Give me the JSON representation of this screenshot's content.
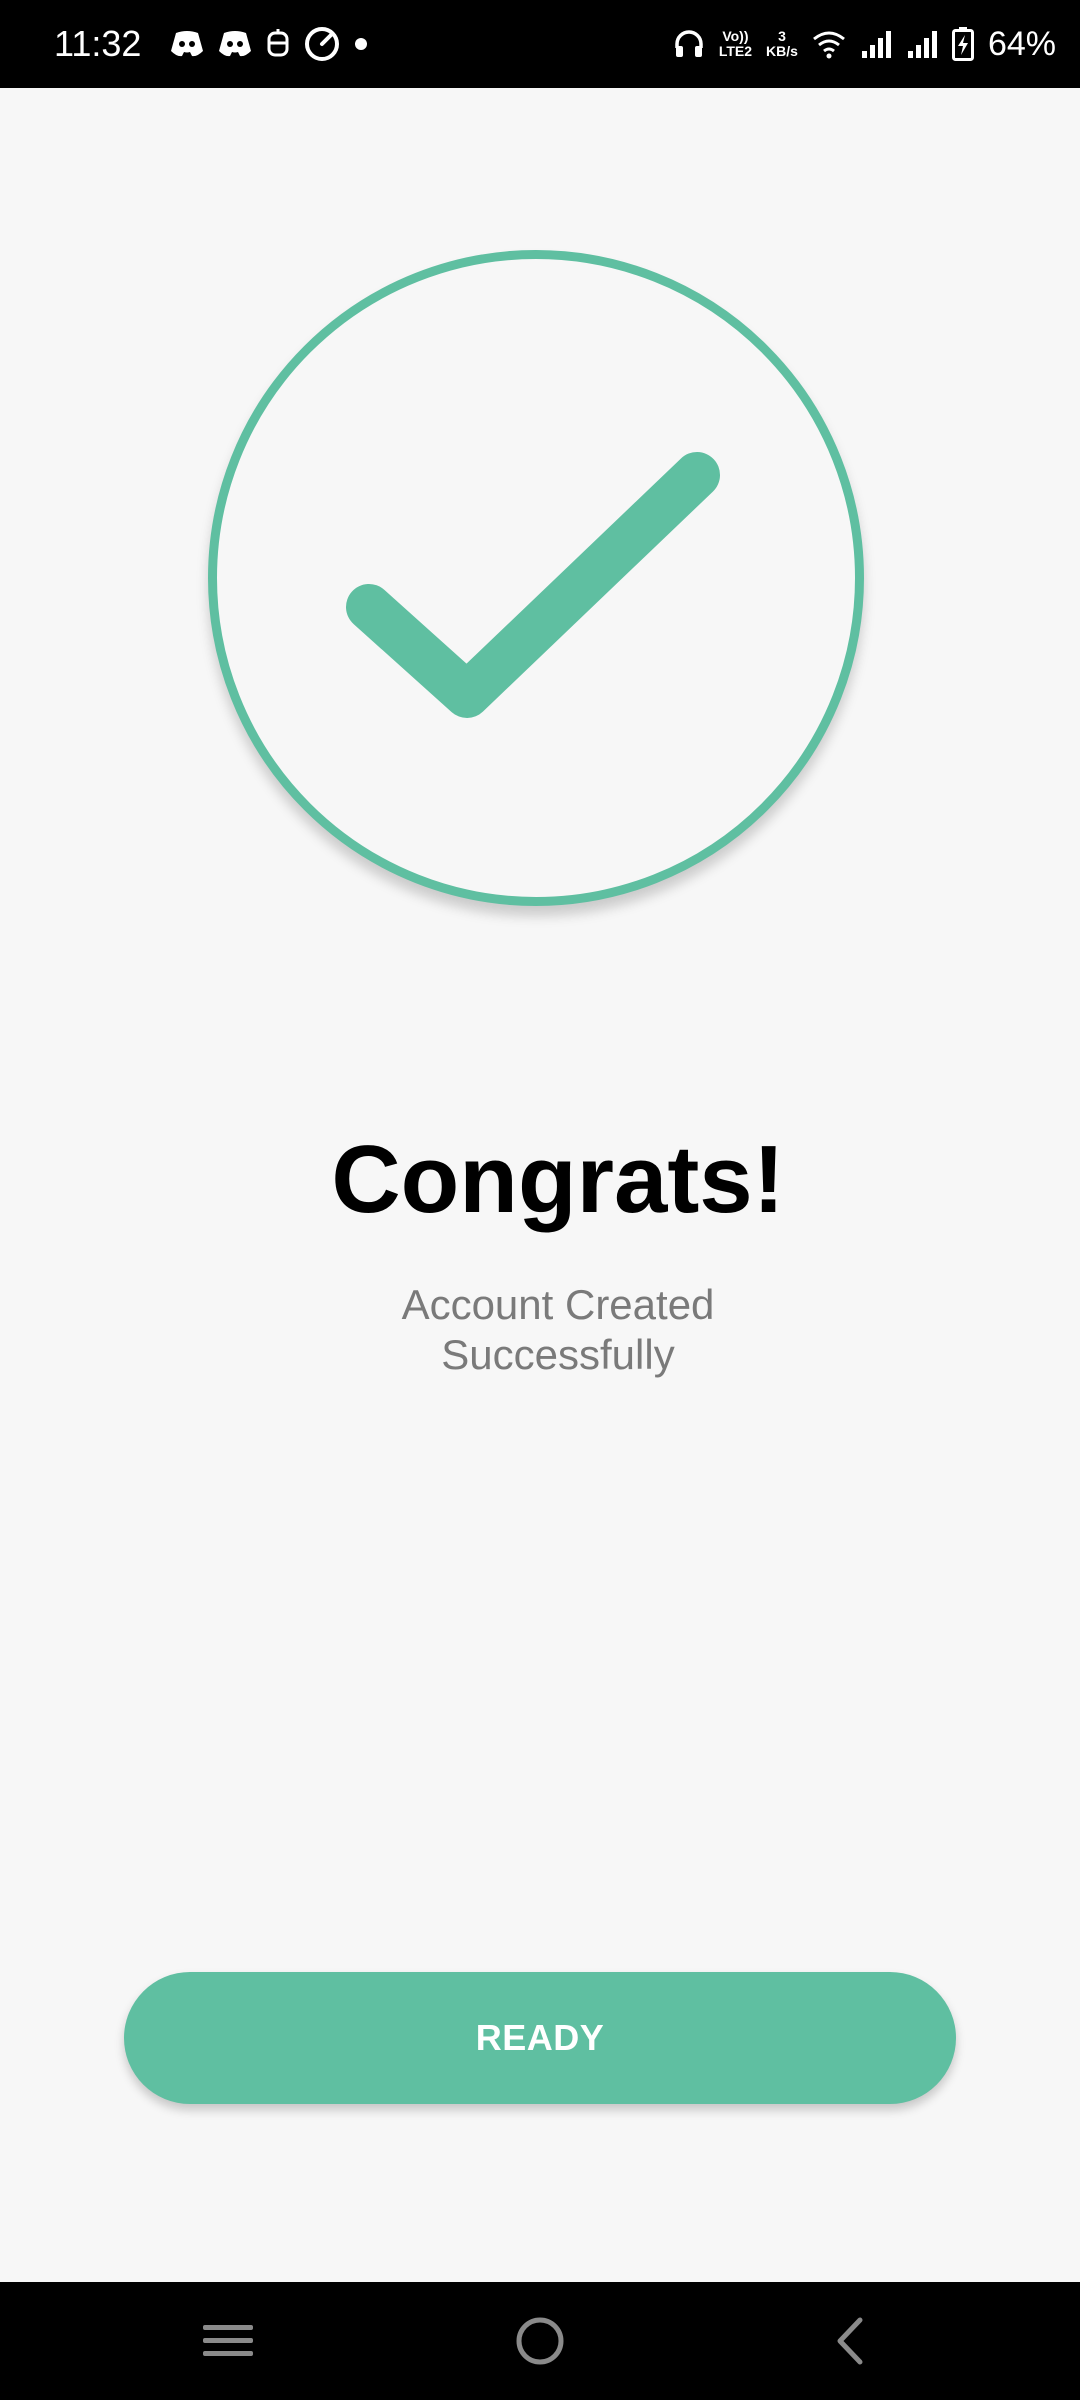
{
  "status_bar": {
    "time": "11:32",
    "volte_top": "Vo))",
    "volte_bottom": "LTE2",
    "speed_value": "3",
    "speed_unit": "KB/s",
    "battery_percent": "64%",
    "notification_icons": [
      "discord-icon",
      "discord-icon",
      "robot-icon",
      "speedometer-icon",
      "dot-icon"
    ],
    "system_icons": [
      "headphones-icon",
      "wifi-icon",
      "signal-icon",
      "signal-icon",
      "battery-charging-icon"
    ]
  },
  "success": {
    "icon": "checkmark-icon",
    "accent_color": "#5fbfa1",
    "title": "Congrats!",
    "message": "Account Created Successfully"
  },
  "actions": {
    "ready_label": "READY"
  },
  "nav_bar": {
    "icons": [
      "menu-icon",
      "home-icon",
      "back-icon"
    ]
  }
}
